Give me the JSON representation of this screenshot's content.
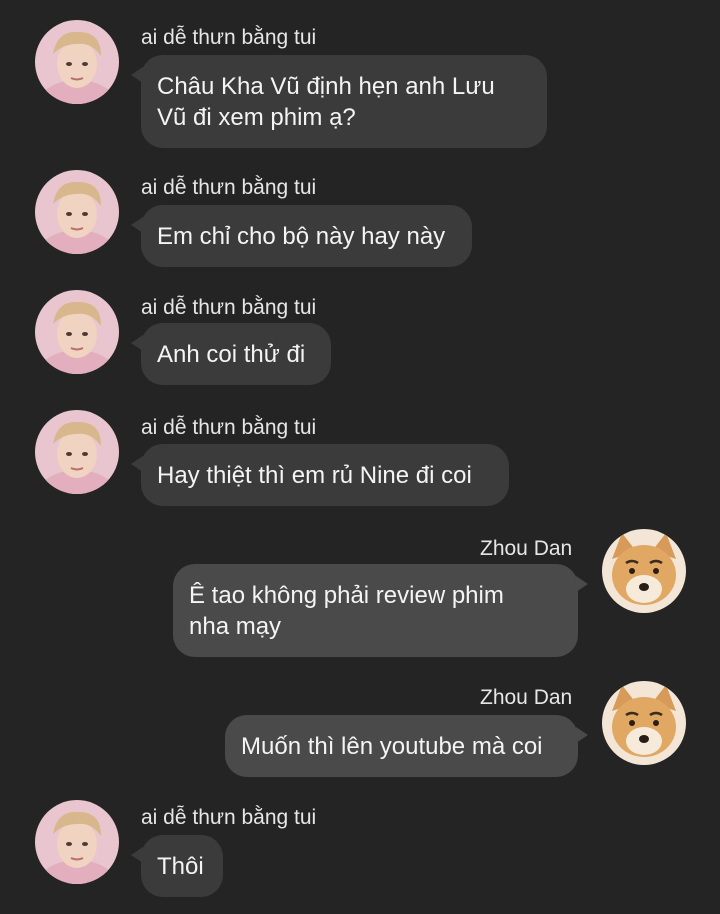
{
  "messages": [
    {
      "side": "left",
      "sender": "ai dễ thưn bằng tui",
      "text": "Châu Kha Vũ định hẹn anh Lưu\nVũ đi xem phim ạ?",
      "avatar": "person-pink-hoodie-avatar"
    },
    {
      "side": "left",
      "sender": "ai dễ thưn bằng tui",
      "text": "Em chỉ cho bộ này hay này",
      "avatar": "person-pink-hoodie-avatar"
    },
    {
      "side": "left",
      "sender": "ai dễ thưn bằng tui",
      "text": "Anh coi thử đi",
      "avatar": "person-pink-hoodie-avatar"
    },
    {
      "side": "left",
      "sender": "ai dễ thưn bằng tui",
      "text": "Hay thiệt thì em rủ Nine đi coi",
      "avatar": "person-pink-hoodie-avatar"
    },
    {
      "side": "right",
      "sender": "Zhou Dan",
      "text": "Ê tao không phải review phim\nnha mạy",
      "avatar": "shiba-dog-avatar"
    },
    {
      "side": "right",
      "sender": "Zhou Dan",
      "text": "Muốn thì lên youtube mà coi",
      "avatar": "shiba-dog-avatar"
    },
    {
      "side": "left",
      "sender": "ai dễ thưn bằng tui",
      "text": "Thôi",
      "avatar": "person-pink-hoodie-avatar"
    }
  ],
  "colors": {
    "background": "#242424",
    "bubble_incoming": "#3b3b3b",
    "bubble_outgoing": "#4a4a4a",
    "text": "#f4f4f4"
  }
}
